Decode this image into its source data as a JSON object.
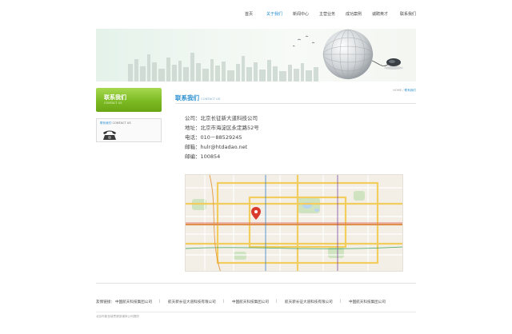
{
  "nav": {
    "items": [
      {
        "label": "首页",
        "active": false
      },
      {
        "label": "关于我们",
        "active": true
      },
      {
        "label": "新闻中心",
        "active": false
      },
      {
        "label": "主营业务",
        "active": false
      },
      {
        "label": "成功案例",
        "active": false
      },
      {
        "label": "诚聘英才",
        "active": false
      },
      {
        "label": "联系我们",
        "active": false
      }
    ]
  },
  "sidebar": {
    "title": "联系我们",
    "subtitle": "CONTACT US",
    "box_label_cn": "联系我们",
    "box_label_en": "CONTACT US"
  },
  "main": {
    "title": "联系我们",
    "subtitle": "CONTACT US",
    "breadcrumb": {
      "home": "HOME",
      "separator": "/",
      "current": "联系我们"
    },
    "info": [
      "公司：北京长征新大道科技公司",
      "地址：北京市海淀区永定路52号",
      "电话：010－88529245",
      "邮箱：hulr@htdadao.net",
      "邮编：100854"
    ]
  },
  "footer": {
    "links_label": "友情链接：",
    "links": [
      "中国航天科技集团公司",
      "航天新长征大道科技有限公司",
      "中国航天科技集团公司",
      "航天新长征大道科技有限公司",
      "中国航天科技集团公司"
    ],
    "separator": "|",
    "copyright": "北京市新加坡思源多媒体公司提供"
  },
  "colors": {
    "accent": "#2a8fd0",
    "sidebar_green": "#7cba22",
    "text": "#444444"
  },
  "icons": [
    "telephone-icon",
    "map-pin-icon",
    "globe-mouse-banner"
  ]
}
